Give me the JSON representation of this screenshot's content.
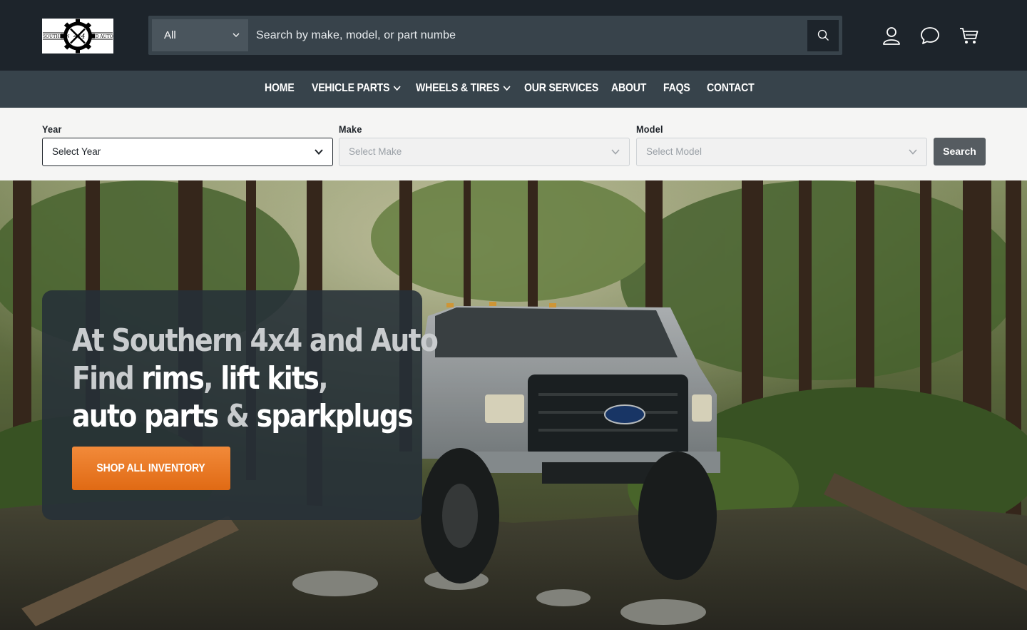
{
  "header": {
    "logo": {
      "left_text": "SOUTHERN",
      "center_text": "4x4",
      "right_text": "AND AUTO"
    },
    "search": {
      "category": "All",
      "placeholder": "Search by make, model, or part numbe"
    },
    "icons": [
      "account-icon",
      "chat-icon",
      "cart-icon"
    ]
  },
  "nav": {
    "items": [
      {
        "label": "HOME",
        "dropdown": false
      },
      {
        "label": "VEHICLE PARTS",
        "dropdown": true
      },
      {
        "label": "WHEELS & TIRES",
        "dropdown": true
      },
      {
        "label": "OUR SERVICES",
        "dropdown": false
      },
      {
        "label": "ABOUT",
        "dropdown": false
      },
      {
        "label": "FAQS",
        "dropdown": false
      },
      {
        "label": "CONTACT",
        "dropdown": false
      }
    ]
  },
  "finder": {
    "year": {
      "label": "Year",
      "value": "Select Year"
    },
    "make": {
      "label": "Make",
      "value": "Select Make"
    },
    "model": {
      "label": "Model",
      "value": "Select Model"
    },
    "search_label": "Search"
  },
  "hero": {
    "line1": "At Southern 4x4 and Auto",
    "line2_a": "Find ",
    "line2_b": "rims",
    "line2_c": ", ",
    "line2_d": "lift kits",
    "line2_e": ",",
    "line3_a": "auto parts",
    "line3_b": " & ",
    "line3_c": "sparkplugs",
    "cta": "SHOP ALL INVENTORY"
  },
  "colors": {
    "header_bg": "#1d242b",
    "nav_bg": "#37434b",
    "cta_orange": "#e8791f",
    "card_bg": "#263038"
  }
}
